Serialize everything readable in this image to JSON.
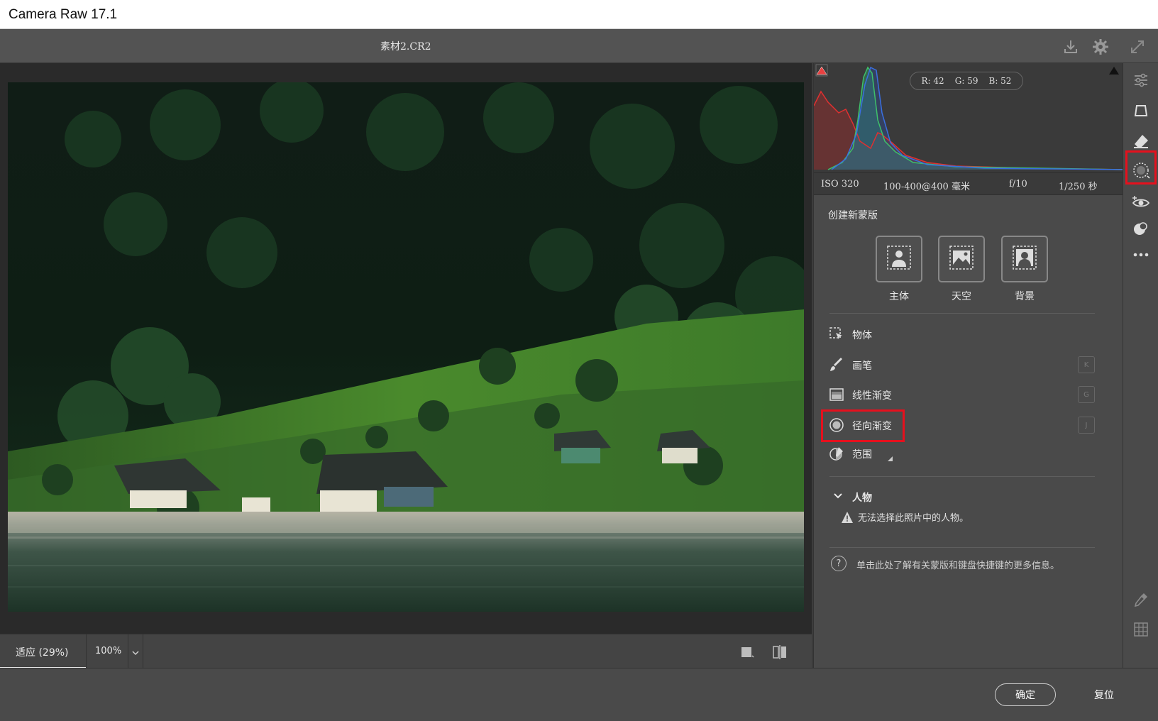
{
  "window": {
    "title": "Camera Raw 17.1"
  },
  "topbar": {
    "filename": "素材2.CR2",
    "icons": [
      "download-icon",
      "gear-icon",
      "fullscreen-icon"
    ]
  },
  "zoom": {
    "fit_label": "适应 (29%)",
    "percent_label": "100%"
  },
  "histogram": {
    "rgb": {
      "r": "R: 42",
      "g": "G: 59",
      "b": "B: 52"
    },
    "colors": {
      "red": "#e03030",
      "green": "#3ec06a",
      "blue": "#3a6fe0"
    }
  },
  "meta": {
    "iso": "ISO 320",
    "lens": "100-400@400 毫米",
    "aperture": "f/10",
    "shutter": "1/250 秒"
  },
  "masks": {
    "section_title": "创建新蒙版",
    "presets": [
      {
        "label": "主体",
        "icon": "subject-icon"
      },
      {
        "label": "天空",
        "icon": "sky-icon"
      },
      {
        "label": "背景",
        "icon": "background-icon"
      }
    ],
    "tools": [
      {
        "label": "物体",
        "icon": "object-select-icon",
        "key": ""
      },
      {
        "label": "画笔",
        "icon": "brush-icon",
        "key": "K"
      },
      {
        "label": "线性渐变",
        "icon": "linear-gradient-icon",
        "key": "G"
      },
      {
        "label": "径向渐变",
        "icon": "radial-gradient-icon",
        "key": "J"
      },
      {
        "label": "范围",
        "icon": "range-icon",
        "key": ""
      }
    ],
    "people": {
      "title": "人物",
      "warning": "无法选择此照片中的人物。"
    },
    "help_text": "单击此处了解有关蒙版和键盘快捷键的更多信息。"
  },
  "footer": {
    "ok_label": "确定",
    "reset_label": "复位"
  },
  "accent": {
    "highlight": "#e6101d"
  }
}
